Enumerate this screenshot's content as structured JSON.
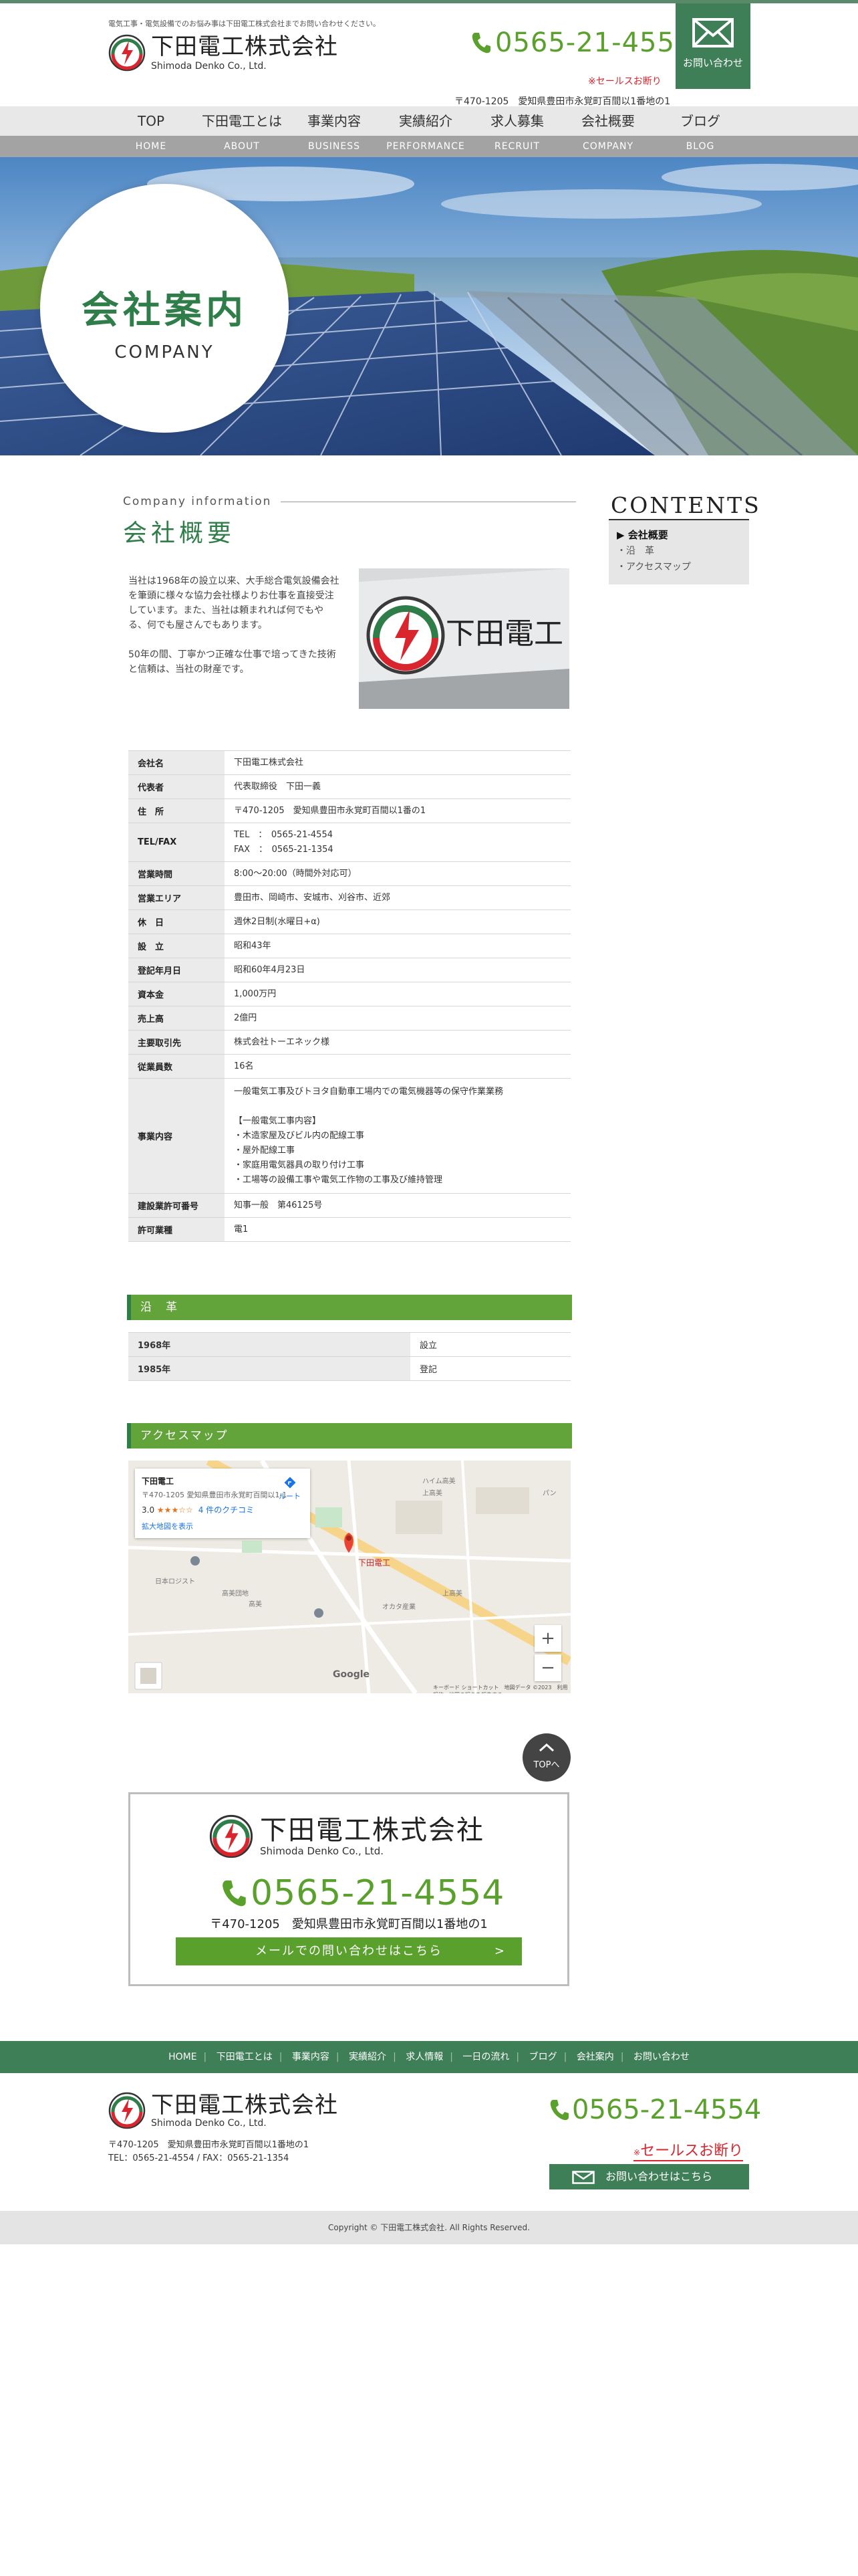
{
  "header": {
    "tagline": "電気工事・電気設備でのお悩み事は下田電工株式会社までお問い合わせください。",
    "company_jp": "下田電工株式会社",
    "company_en": "Shimoda Denko Co., Ltd.",
    "phone": "0565-21-4554",
    "sales_label": "※セールスお断り",
    "address": "〒470-1205　愛知県豊田市永覚町百間以1番地の1",
    "contact_label": "お問い合わせ"
  },
  "nav": [
    {
      "jp": "TOP",
      "en": "HOME"
    },
    {
      "jp": "下田電工とは",
      "en": "ABOUT"
    },
    {
      "jp": "事業内容",
      "en": "BUSINESS"
    },
    {
      "jp": "実績紹介",
      "en": "PERFORMANCE"
    },
    {
      "jp": "求人募集",
      "en": "RECRUIT"
    },
    {
      "jp": "会社概要",
      "en": "COMPANY"
    },
    {
      "jp": "ブログ",
      "en": "BLOG"
    }
  ],
  "hero": {
    "jp": "会社案内",
    "en": "COMPANY"
  },
  "section": {
    "en": "Company information",
    "jp": "会社概要"
  },
  "intro": [
    "当社は1968年の設立以来、大手総合電気設備会社を筆頭に様々な協力会社様よりお仕事を直接受注しています。また、当社は頼まれれば何でもやる、何でも屋さんでもあります。",
    "50年の間、丁寧かつ正確な仕事で培ってきた技術と信頼は、当社の財産です。"
  ],
  "photo_sign_text": "下田電工",
  "sidebar": {
    "title": "CONTENTS",
    "items": [
      "会社概要",
      "沿　革",
      "アクセスマップ"
    ]
  },
  "info_table": [
    {
      "k": "会社名",
      "v": "下田電工株式会社"
    },
    {
      "k": "代表者",
      "v": "代表取締役　下田一義"
    },
    {
      "k": "住　所",
      "v": "〒470-1205　愛知県豊田市永覚町百間以1番の1"
    },
    {
      "k": "TEL/FAX",
      "v": "TEL　：　0565-21-4554\nFAX　：　0565-21-1354"
    },
    {
      "k": "営業時間",
      "v": "8:00〜20:00（時間外対応可）"
    },
    {
      "k": "営業エリア",
      "v": "豊田市、岡崎市、安城市、刈谷市、近郊"
    },
    {
      "k": "休　日",
      "v": "週休2日制(水曜日+α)"
    },
    {
      "k": "設　立",
      "v": "昭和43年"
    },
    {
      "k": "登記年月日",
      "v": "昭和60年4月23日"
    },
    {
      "k": "資本金",
      "v": "1,000万円"
    },
    {
      "k": "売上高",
      "v": "2億円"
    },
    {
      "k": "主要取引先",
      "v": "株式会社トーエネック様"
    },
    {
      "k": "従業員数",
      "v": "16名"
    },
    {
      "k": "事業内容",
      "v": "一般電気工事及びトヨタ自動車工場内での電気機器等の保守作業業務\n\n【一般電気工事内容】\n・木造家屋及びビル内の配線工事\n・屋外配線工事\n・家庭用電気器具の取り付け工事\n・工場等の設備工事や電気工作物の工事及び維持管理"
    },
    {
      "k": "建設業許可番号",
      "v": "知事一般　第46125号"
    },
    {
      "k": "許可業種",
      "v": "電1"
    }
  ],
  "history_title": "沿　革",
  "history": [
    {
      "k": "1968年",
      "v": "設立"
    },
    {
      "k": "1985年",
      "v": "登記"
    }
  ],
  "access_title": "アクセスマップ",
  "map": {
    "card_title": "下田電工",
    "card_address": "〒470-1205 愛知県豊田市永覚町百間以1-1",
    "rating": "3.0",
    "stars": "★★★☆☆",
    "reviews": "4 件のクチコミ",
    "larger_map": "拡大地図を表示",
    "directions": "ルート",
    "pin_label": "下田電工",
    "areas": [
      "ハイム高美",
      "上高美",
      "日本ロジスト",
      "高美団地",
      "高美",
      "オカタ産業",
      "上高美",
      "パン"
    ],
    "google": "Google",
    "copyright": "キーボード ショートカット　地図データ ©2023　利用規約　地図の誤りを報告する"
  },
  "totop": "TOPへ",
  "contact_box": {
    "company_jp": "下田電工株式会社",
    "company_en": "Shimoda Denko Co., Ltd.",
    "phone": "0565-21-4554",
    "address": "〒470-1205　愛知県豊田市永覚町百間以1番地の1",
    "button": "メールでの問い合わせはこちら",
    "arrow": ">"
  },
  "footer_nav": [
    "HOME",
    "下田電工とは",
    "事業内容",
    "実績紹介",
    "求人情報",
    "一日の流れ",
    "ブログ",
    "会社案内",
    "お問い合わせ"
  ],
  "footer": {
    "company_jp": "下田電工株式会社",
    "company_en": "Shimoda Denko Co., Ltd.",
    "address": "〒470-1205　愛知県豊田市永覚町百間以1番地の1",
    "telfax": "TEL：0565-21-4554 / FAX：0565-21-1354",
    "phone": "0565-21-4554",
    "sales_prefix": "※",
    "sales": "セールスお断り",
    "button": "お問い合わせはこちら",
    "copyright": "Copyright © 下田電工株式会社. All Rights Reserved."
  },
  "colors": {
    "brand_green": "#3f7f57",
    "accent_green": "#5aa02c",
    "bar_green": "#62a33a",
    "heading_green": "#2f7d48",
    "alert_red": "#d9262e"
  }
}
